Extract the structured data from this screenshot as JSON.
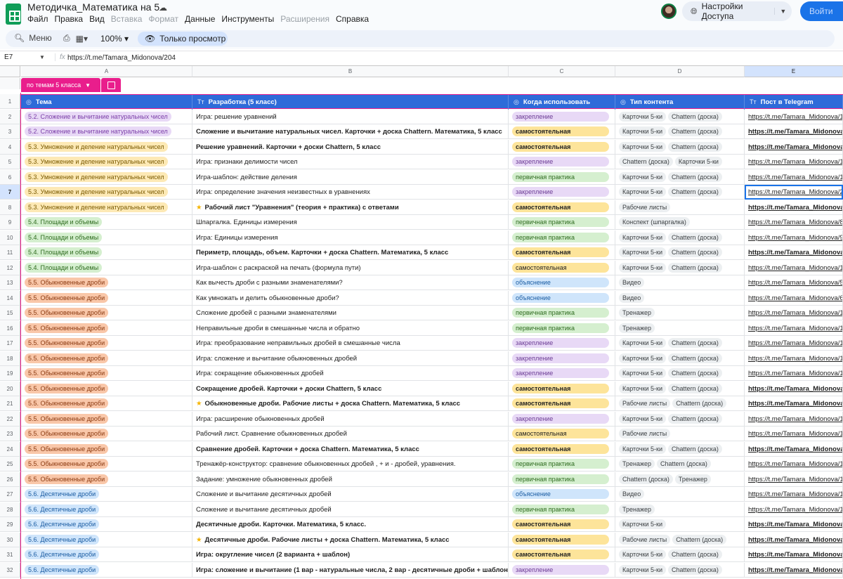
{
  "app": {
    "title": "Методичка_Математика на 5",
    "menu": [
      {
        "label": "Файл",
        "enabled": true
      },
      {
        "label": "Правка",
        "enabled": true
      },
      {
        "label": "Вид",
        "enabled": true
      },
      {
        "label": "Вставка",
        "enabled": false
      },
      {
        "label": "Формат",
        "enabled": false
      },
      {
        "label": "Данные",
        "enabled": true
      },
      {
        "label": "Инструменты",
        "enabled": true
      },
      {
        "label": "Расширения",
        "enabled": false
      },
      {
        "label": "Справка",
        "enabled": true
      }
    ],
    "access_label": "Настройки Доступа",
    "share_label": "Войти"
  },
  "toolbar": {
    "search_label": "Меню",
    "zoom": "100%",
    "view_only_label": "Только просмотр"
  },
  "formula": {
    "cell_ref": "E7",
    "fx": "fx",
    "value": "https://t.me/Tamara_Midonova/204"
  },
  "columns": [
    "A",
    "B",
    "C",
    "D",
    "E"
  ],
  "selected_column": "E",
  "view": {
    "tab_label": "по темам 5 класса"
  },
  "header_row": {
    "num": "1",
    "cells": [
      "Тема",
      "Разработка (5 класс)",
      "Когда использовать",
      "Тип контента",
      "Пост в Telegram"
    ],
    "icons": [
      "◎",
      "Tт",
      "◎",
      "◎",
      "Tт"
    ]
  },
  "selected_row": "7",
  "rows": [
    {
      "num": "2",
      "topic": "5.2. Сложение и вычитание натуральных чисел",
      "tcls": "chip-52",
      "title": "Игра: решение уравнений",
      "bold": false,
      "star": false,
      "stage": "закрепление",
      "scls": "st-zakr",
      "types": [
        "Карточки 5-ки",
        "Chattern (доска)"
      ],
      "link": "https://t.me/Tamara_Midonova/1"
    },
    {
      "num": "3",
      "topic": "5.2. Сложение и вычитание натуральных чисел",
      "tcls": "chip-52",
      "title": "Сложение и вычитание натуральных чисел. Карточки + доска Chattern. Математика, 5 класс",
      "bold": true,
      "star": false,
      "stage": "самостоятельная",
      "scls": "st-sam",
      "types": [
        "Карточки 5-ки",
        "Chattern (доска)"
      ],
      "link": "https://t.me/Tamara_Midonova/1"
    },
    {
      "num": "4",
      "topic": "5.3. Умножение и деление натуральных чисел",
      "tcls": "chip-53",
      "title": "Решение уравнений. Карточки + доски Chattern, 5 класс",
      "bold": true,
      "star": false,
      "stage": "самостоятельная",
      "scls": "st-sam",
      "types": [
        "Карточки 5-ки",
        "Chattern (доска)"
      ],
      "link": "https://t.me/Tamara_Midonova/9"
    },
    {
      "num": "5",
      "topic": "5.3. Умножение и деление натуральных чисел",
      "tcls": "chip-53",
      "title": "Игра: признаки делимости чисел",
      "bold": false,
      "star": false,
      "stage": "закрепление",
      "scls": "st-zakr",
      "types": [
        "Chattern (доска)",
        "Карточки 5-ки"
      ],
      "link": "https://t.me/Tamara_Midonova/1"
    },
    {
      "num": "6",
      "topic": "5.3. Умножение и деление натуральных чисел",
      "tcls": "chip-53",
      "title": "Игра-шаблон: действие деления",
      "bold": false,
      "star": false,
      "stage": "первичная практика",
      "scls": "st-perv",
      "types": [
        "Карточки 5-ки",
        "Chattern (доска)"
      ],
      "link": "https://t.me/Tamara_Midonova/1"
    },
    {
      "num": "7",
      "topic": "5.3. Умножение и деление натуральных чисел",
      "tcls": "chip-53",
      "title": "Игра: определение значения неизвестных в уравнениях",
      "bold": false,
      "star": false,
      "stage": "закрепление",
      "scls": "st-zakr",
      "types": [
        "Карточки 5-ки",
        "Chattern (доска)"
      ],
      "link": "https://t.me/Tamara_Midonova/2"
    },
    {
      "num": "8",
      "topic": "5.3. Умножение и деление натуральных чисел",
      "tcls": "chip-53",
      "title": "Рабочий лист \"Уравнения\" (теория + практика) с ответами",
      "bold": true,
      "star": true,
      "stage": "самостоятельная",
      "scls": "st-sam",
      "types": [
        "Рабочие листы"
      ],
      "link": "https://t.me/Tamara_Midonova/2"
    },
    {
      "num": "9",
      "topic": "5.4. Площади и объемы",
      "tcls": "chip-54",
      "title": "Шпаргалка. Единицы измерения",
      "bold": false,
      "star": false,
      "stage": "первичная практика",
      "scls": "st-perv",
      "types": [
        "Конспект (шпаргалка)"
      ],
      "link": "https://t.me/Tamara_Midonova/8"
    },
    {
      "num": "10",
      "topic": "5.4. Площади и объемы",
      "tcls": "chip-54",
      "title": "Игра: Единицы измерения",
      "bold": false,
      "star": false,
      "stage": "первичная практика",
      "scls": "st-perv",
      "types": [
        "Карточки 5-ки",
        "Chattern (доска)"
      ],
      "link": "https://t.me/Tamara_Midonova/9"
    },
    {
      "num": "11",
      "topic": "5.4. Площади и объемы",
      "tcls": "chip-54",
      "title": "Периметр, площадь, объем. Карточки + доска Chattern. Математика, 5 класс",
      "bold": true,
      "star": false,
      "stage": "самостоятельная",
      "scls": "st-sam",
      "types": [
        "Карточки 5-ки",
        "Chattern (доска)"
      ],
      "link": "https://t.me/Tamara_Midonova/1"
    },
    {
      "num": "12",
      "topic": "5.4. Площади и объемы",
      "tcls": "chip-54",
      "title": "Игра-шаблон с раскраской на печать (формула пути)",
      "bold": false,
      "star": false,
      "stage": "самостоятельная",
      "scls": "st-sam-light",
      "types": [
        "Карточки 5-ки",
        "Chattern (доска)"
      ],
      "link": "https://t.me/Tamara_Midonova/1"
    },
    {
      "num": "13",
      "topic": "5.5. Обыкновенные дроби",
      "tcls": "chip-55",
      "title": "Как вычесть дроби с разными знаменателями?",
      "bold": false,
      "star": false,
      "stage": "объяснение",
      "scls": "st-obj",
      "types": [
        "Видео"
      ],
      "link": "https://t.me/Tamara_Midonova/5"
    },
    {
      "num": "14",
      "topic": "5.5. Обыкновенные дроби",
      "tcls": "chip-55",
      "title": "Как умножать и делить обыкновенные дроби?",
      "bold": false,
      "star": false,
      "stage": "объяснение",
      "scls": "st-obj",
      "types": [
        "Видео"
      ],
      "link": "https://t.me/Tamara_Midonova/6"
    },
    {
      "num": "15",
      "topic": "5.5. Обыкновенные дроби",
      "tcls": "chip-55",
      "title": "Сложение дробей с разными знаменателями",
      "bold": false,
      "star": false,
      "stage": "первичная практика",
      "scls": "st-perv",
      "types": [
        "Тренажер"
      ],
      "link": "https://t.me/Tamara_Midonova/1"
    },
    {
      "num": "16",
      "topic": "5.5. Обыкновенные дроби",
      "tcls": "chip-55",
      "title": "Неправильные дроби в смешанные числа и обратно",
      "bold": false,
      "star": false,
      "stage": "первичная практика",
      "scls": "st-perv",
      "types": [
        "Тренажер"
      ],
      "link": "https://t.me/Tamara_Midonova/1"
    },
    {
      "num": "17",
      "topic": "5.5. Обыкновенные дроби",
      "tcls": "chip-55",
      "title": "Игра: преобразование неправильных дробей в смешанные числа",
      "bold": false,
      "star": false,
      "stage": "закрепление",
      "scls": "st-zakr",
      "types": [
        "Карточки 5-ки",
        "Chattern (доска)"
      ],
      "link": "https://t.me/Tamara_Midonova/1"
    },
    {
      "num": "18",
      "topic": "5.5. Обыкновенные дроби",
      "tcls": "chip-55",
      "title": "Игра: сложение и вычитание обыкновенных дробей",
      "bold": false,
      "star": false,
      "stage": "закрепление",
      "scls": "st-zakr",
      "types": [
        "Карточки 5-ки",
        "Chattern (доска)"
      ],
      "link": "https://t.me/Tamara_Midonova/1"
    },
    {
      "num": "19",
      "topic": "5.5. Обыкновенные дроби",
      "tcls": "chip-55",
      "title": "Игра: сокращение обыкновенных дробей",
      "bold": false,
      "star": false,
      "stage": "закрепление",
      "scls": "st-zakr",
      "types": [
        "Карточки 5-ки",
        "Chattern (доска)"
      ],
      "link": "https://t.me/Tamara_Midonova/1"
    },
    {
      "num": "20",
      "topic": "5.5. Обыкновенные дроби",
      "tcls": "chip-55",
      "title": "Сокращение дробей. Карточки + доски Chattern, 5 класс",
      "bold": true,
      "star": false,
      "stage": "самостоятельная",
      "scls": "st-sam",
      "types": [
        "Карточки 5-ки",
        "Chattern (доска)"
      ],
      "link": "https://t.me/Tamara_Midonova/8"
    },
    {
      "num": "21",
      "topic": "5.5. Обыкновенные дроби",
      "tcls": "chip-55",
      "title": "Обыкновенные дроби. Рабочие листы + доска Chattern. Математика, 5 класс",
      "bold": true,
      "star": true,
      "stage": "самостоятельная",
      "scls": "st-sam",
      "types": [
        "Рабочие листы",
        "Chattern (доска)"
      ],
      "link": "https://t.me/Tamara_Midonova/8"
    },
    {
      "num": "22",
      "topic": "5.5. Обыкновенные дроби",
      "tcls": "chip-55",
      "title": "Игра: расширение обыкновенных дробей",
      "bold": false,
      "star": false,
      "stage": "закрепление",
      "scls": "st-zakr",
      "types": [
        "Карточки 5-ки",
        "Chattern (доска)"
      ],
      "link": "https://t.me/Tamara_Midonova/1"
    },
    {
      "num": "23",
      "topic": "5.5. Обыкновенные дроби",
      "tcls": "chip-55",
      "title": "Рабочий лист. Сравнение обыкновенных дробей",
      "bold": false,
      "star": false,
      "stage": "самостоятельная",
      "scls": "st-sam-light",
      "types": [
        "Рабочие листы"
      ],
      "link": "https://t.me/Tamara_Midonova/1"
    },
    {
      "num": "24",
      "topic": "5.5. Обыкновенные дроби",
      "tcls": "chip-55",
      "title": "Сравнение дробей. Карточки + доска Chattern. Математика, 5 класс",
      "bold": true,
      "star": false,
      "stage": "самостоятельная",
      "scls": "st-sam",
      "types": [
        "Карточки 5-ки",
        "Chattern (доска)"
      ],
      "link": "https://t.me/Tamara_Midonova/1"
    },
    {
      "num": "25",
      "topic": "5.5. Обыкновенные дроби",
      "tcls": "chip-55",
      "title": "Тренажёр-конструктор: сравнение обыкновенных дробей , + и - дробей, уравнения.",
      "bold": false,
      "star": false,
      "stage": "первичная практика",
      "scls": "st-perv",
      "types": [
        "Тренажер",
        "Chattern (доска)"
      ],
      "link": "https://t.me/Tamara_Midonova/1"
    },
    {
      "num": "26",
      "topic": "5.5. Обыкновенные дроби",
      "tcls": "chip-55",
      "title": "Задание: умножение обыкновенных дробей",
      "bold": false,
      "star": false,
      "stage": "первичная практика",
      "scls": "st-perv",
      "types": [
        "Chattern (доска)",
        "Тренажер"
      ],
      "link": "https://t.me/Tamara_Midonova/1"
    },
    {
      "num": "27",
      "topic": "5.6. Десятичные дроби",
      "tcls": "chip-56",
      "title": "Сложение и вычитание десятичных дробей",
      "bold": false,
      "star": false,
      "stage": "объяснение",
      "scls": "st-obj",
      "types": [
        "Видео"
      ],
      "link": "https://t.me/Tamara_Midonova/1"
    },
    {
      "num": "28",
      "topic": "5.6. Десятичные дроби",
      "tcls": "chip-56",
      "title": "Сложение и вычитание десятичных дробей",
      "bold": false,
      "star": false,
      "stage": "первичная практика",
      "scls": "st-perv",
      "types": [
        "Тренажер"
      ],
      "link": "https://t.me/Tamara_Midonova/1"
    },
    {
      "num": "29",
      "topic": "5.6. Десятичные дроби",
      "tcls": "chip-56",
      "title": "Десятичные дроби. Карточки. Математика, 5 класс.",
      "bold": true,
      "star": false,
      "stage": "самостоятельная",
      "scls": "st-sam",
      "types": [
        "Карточки 5-ки"
      ],
      "link": "https://t.me/Tamara_Midonova/1"
    },
    {
      "num": "30",
      "topic": "5.6. Десятичные дроби",
      "tcls": "chip-56",
      "title": "Десятичные дроби. Рабочие листы + доска Chattern. Математика, 5 класс",
      "bold": true,
      "star": true,
      "stage": "самостоятельная",
      "scls": "st-sam",
      "types": [
        "Рабочие листы",
        "Chattern (доска)"
      ],
      "link": "https://t.me/Tamara_Midonova/1"
    },
    {
      "num": "31",
      "topic": "5.6. Десятичные дроби",
      "tcls": "chip-56",
      "title": "Игра: округление чисел (2 варианта + шаблон)",
      "bold": true,
      "star": false,
      "stage": "самостоятельная",
      "scls": "st-sam",
      "types": [
        "Карточки 5-ки",
        "Chattern (доска)"
      ],
      "link": "https://t.me/Tamara_Midonova/1"
    },
    {
      "num": "32",
      "topic": "5.6. Десятичные дроби",
      "tcls": "chip-56",
      "title": "Игра: сложение и вычитание (1 вар - натуральные числа, 2 вар - десятичные дроби + шаблон)",
      "bold": true,
      "star": false,
      "stage": "закрепление",
      "scls": "st-zakr",
      "types": [
        "Карточки 5-ки",
        "Chattern (доска)"
      ],
      "link": "https://t.me/Tamara_Midonova/1"
    }
  ]
}
